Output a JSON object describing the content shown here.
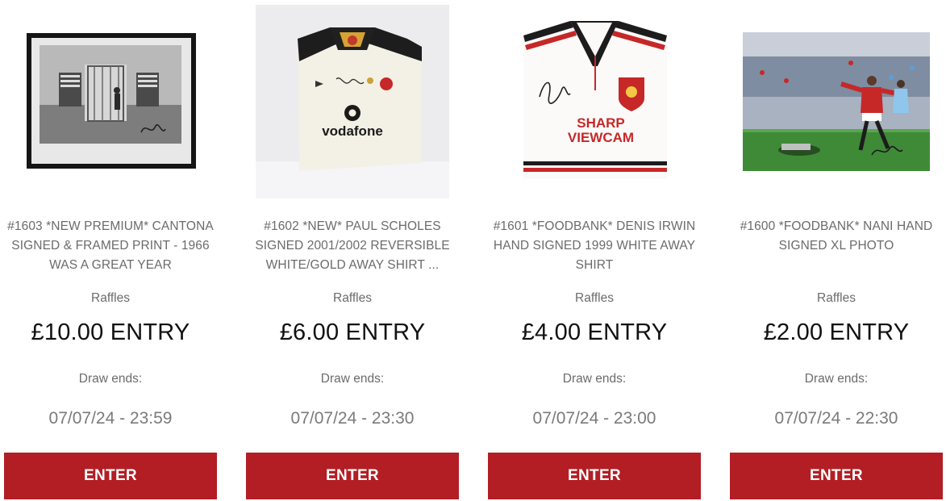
{
  "products": [
    {
      "title": "#1603 *NEW PREMIUM* CANTONA SIGNED & FRAMED PRINT - 1966 WAS A GREAT YEAR",
      "category": "Raffles",
      "price": "£10.00 ENTRY",
      "draw_label": "Draw ends:",
      "draw_date": "07/07/24 - 23:59",
      "button": "ENTER",
      "image": "framed-signed-print"
    },
    {
      "title": "#1602 *NEW* PAUL SCHOLES SIGNED 2001/2002 REVERSIBLE WHITE/GOLD AWAY SHIRT ...",
      "category": "Raffles",
      "price": "£6.00 ENTRY",
      "draw_label": "Draw ends:",
      "draw_date": "07/07/24 - 23:30",
      "button": "ENTER",
      "image": "signed-white-away-shirt",
      "image_text": "vodafone"
    },
    {
      "title": "#1601 *FOODBANK* DENIS IRWIN HAND SIGNED 1999 WHITE AWAY SHIRT",
      "category": "Raffles",
      "price": "£4.00 ENTRY",
      "draw_label": "Draw ends:",
      "draw_date": "07/07/24 - 23:00",
      "button": "ENTER",
      "image": "signed-white-away-shirt-1999",
      "image_text": [
        "SHARP",
        "VIEWCAM"
      ]
    },
    {
      "title": "#1600 *FOODBANK* NANI HAND SIGNED XL PHOTO",
      "category": "Raffles",
      "price": "£2.00 ENTRY",
      "draw_label": "Draw ends:",
      "draw_date": "07/07/24 - 22:30",
      "button": "ENTER",
      "image": "signed-match-photo"
    }
  ],
  "colors": {
    "button_bg": "#b21e24",
    "button_text": "#ffffff",
    "title_text": "#6b6b6b",
    "price_text": "#111111"
  }
}
